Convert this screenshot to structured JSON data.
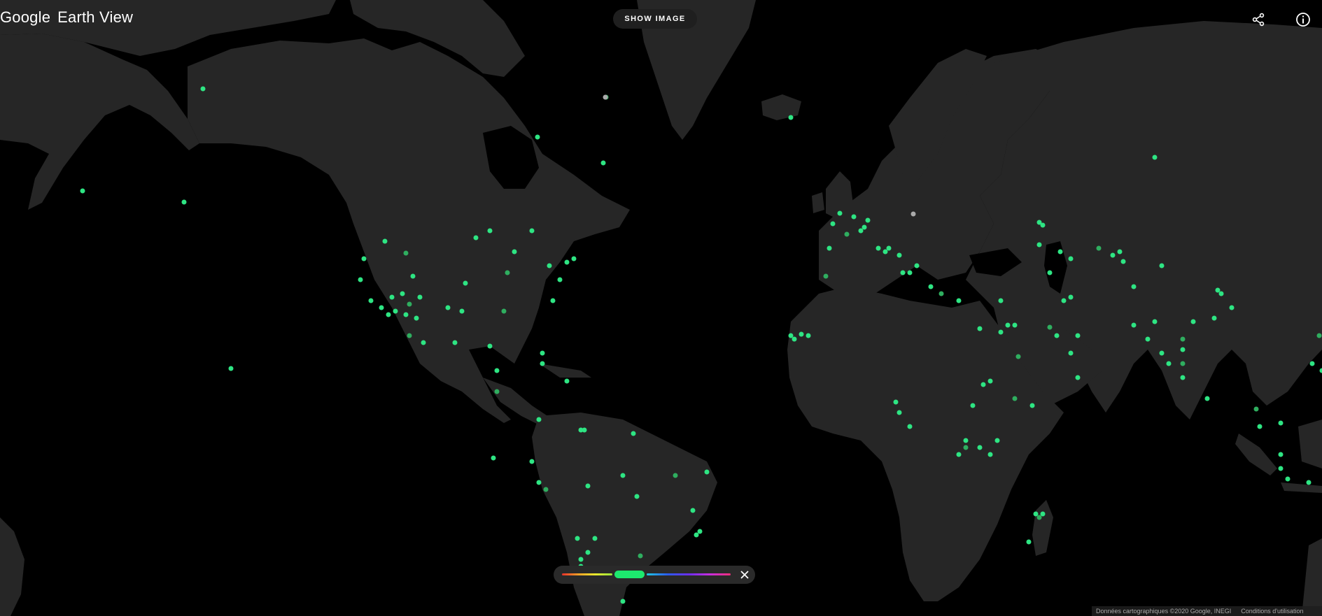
{
  "brand": {
    "google": "Google",
    "product": "Earth View"
  },
  "toolbar": {
    "show_image_label": "SHOW IMAGE",
    "share_icon": "share-icon",
    "info_icon": "info-icon"
  },
  "colors": {
    "accent_green": "#1de96e",
    "land": "#262626",
    "ocean": "#000000"
  },
  "color_filter": {
    "selected": "green",
    "close_icon": "close-icon"
  },
  "attribution": {
    "map_data": "Données cartographiques ©2020 Google, INEGI",
    "terms": "Conditions d'utilisation"
  }
}
